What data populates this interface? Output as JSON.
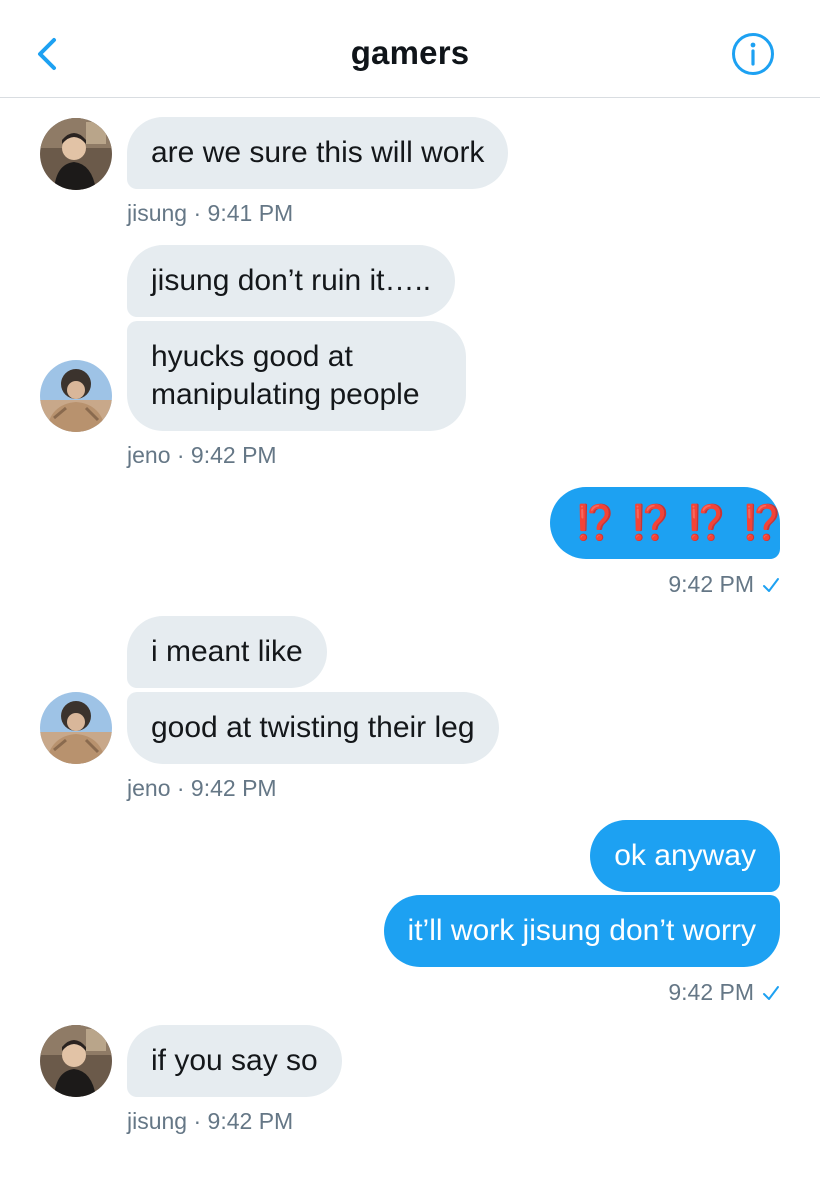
{
  "header": {
    "title": "gamers",
    "back_icon": "chevron-left-icon",
    "info_icon": "info-icon",
    "accent_color": "#1da1f2"
  },
  "messages": [
    {
      "from": "jisung",
      "text": "are we sure this will work"
    },
    {
      "meta": "jisung · 9:41 PM"
    },
    {
      "from": "jeno",
      "text": "jisung don’t ruin it….."
    },
    {
      "from": "jeno",
      "text": "hyucks good at manipulating people"
    },
    {
      "meta": "jeno · 9:42 PM"
    },
    {
      "from": "me",
      "text": "⁉️ ⁉️ ⁉️ ⁉️"
    },
    {
      "meta": "9:42 PM"
    },
    {
      "from": "jeno",
      "text": "i meant like"
    },
    {
      "from": "jeno",
      "text": "good at twisting their leg"
    },
    {
      "meta": "jeno · 9:42 PM"
    },
    {
      "from": "me",
      "text": "ok anyway"
    },
    {
      "from": "me",
      "text": "it’ll work jisung don’t worry"
    },
    {
      "meta": "9:42 PM"
    },
    {
      "from": "jisung",
      "text": "if you say so"
    },
    {
      "meta": "jisung · 9:42 PM"
    }
  ],
  "colors": {
    "incoming_bubble": "#e6ecf0",
    "outgoing_bubble": "#1da1f2",
    "meta_text": "#657786"
  }
}
